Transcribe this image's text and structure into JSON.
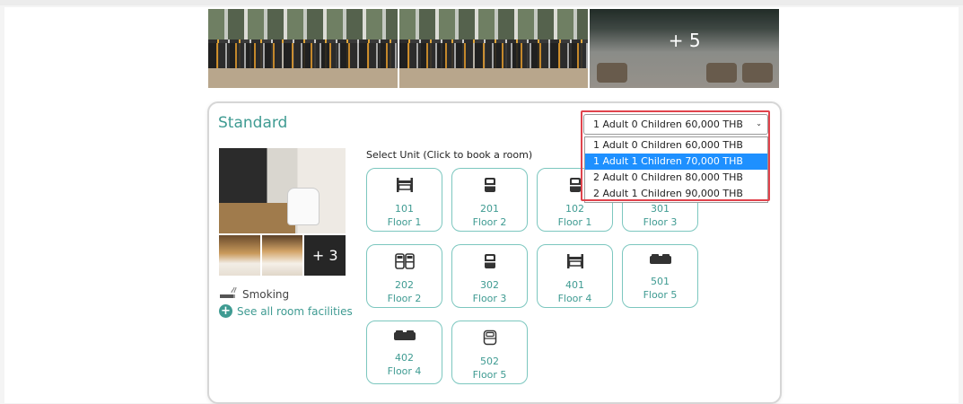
{
  "gallery": {
    "more_count": "+ 5"
  },
  "room": {
    "title": "Standard",
    "more_photos": "+ 3",
    "facility": "Smoking",
    "see_all": "See all room facilities",
    "select_label": "Select Unit (Click to book a room)"
  },
  "units": [
    {
      "number": "101",
      "floor": "Floor 1",
      "icon": "twin-bed-icon"
    },
    {
      "number": "201",
      "floor": "Floor 2",
      "icon": "single-bed-icon"
    },
    {
      "number": "102",
      "floor": "Floor 1",
      "icon": "single-bed-icon"
    },
    {
      "number": "301",
      "floor": "Floor 3",
      "icon": "twin-bed-icon"
    },
    {
      "number": "202",
      "floor": "Floor 2",
      "icon": "two-beds-icon"
    },
    {
      "number": "302",
      "floor": "Floor 3",
      "icon": "single-bed-icon"
    },
    {
      "number": "401",
      "floor": "Floor 4",
      "icon": "twin-bed-icon"
    },
    {
      "number": "501",
      "floor": "Floor 5",
      "icon": "double-bed-icon"
    },
    {
      "number": "402",
      "floor": "Floor 4",
      "icon": "double-bed-icon"
    },
    {
      "number": "502",
      "floor": "Floor 5",
      "icon": "bed-outline-icon"
    }
  ],
  "occupancy_select": {
    "value": "1 Adult 0 Children 60,000 THB",
    "options": [
      "1 Adult 0 Children 60,000 THB",
      "1 Adult 1 Children 70,000 THB",
      "2 Adult 0 Children 80,000 THB",
      "2 Adult 1 Children 90,000 THB"
    ],
    "highlighted_index": 1
  },
  "colors": {
    "accent": "#3f9b92",
    "selected_option": "#1e90ff",
    "highlight_border": "#e0434c"
  }
}
